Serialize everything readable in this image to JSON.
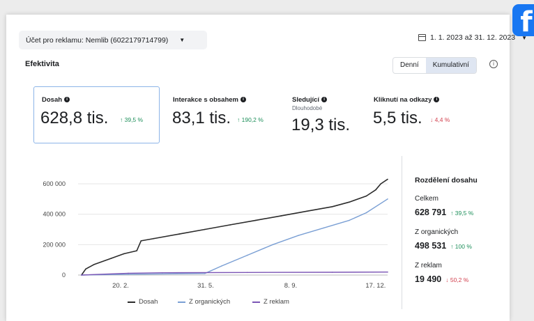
{
  "account": {
    "label": "Účet pro reklamu: Nemlib (6022179714799)"
  },
  "date_range": {
    "label": "1. 1. 2023 až 31. 12. 2023"
  },
  "section": {
    "title": "Efektivita"
  },
  "toggle": {
    "daily": "Denní",
    "cumulative": "Kumulativní",
    "active": "Kumulativní"
  },
  "metrics": [
    {
      "label": "Dosah",
      "value": "628,8 tis.",
      "delta": "↑ 39,5 %",
      "trend": "up"
    },
    {
      "label": "Interakce s obsahem",
      "value": "83,1 tis.",
      "delta": "↑ 190,2 %",
      "trend": "up"
    },
    {
      "label": "Sledující",
      "sub": "Dlouhodobé",
      "value": "19,3 tis."
    },
    {
      "label": "Kliknutí na odkazy",
      "value": "5,5 tis.",
      "delta": "↓ 4,4 %",
      "trend": "down"
    }
  ],
  "breakdown": {
    "title": "Rozdělení dosahu",
    "items": [
      {
        "label": "Celkem",
        "value": "628 791",
        "delta": "↑ 39,5 %",
        "trend": "up"
      },
      {
        "label": "Z organických",
        "value": "498 531",
        "delta": "↑ 100 %",
        "trend": "up"
      },
      {
        "label": "Z reklam",
        "value": "19 490",
        "delta": "↓ 50,2 %",
        "trend": "down"
      }
    ]
  },
  "colors": {
    "dosah": "#2b2b2b",
    "organic": "#7a9fd4",
    "ads": "#7b55b5",
    "up": "#1d8f5a",
    "down": "#d2404e"
  },
  "chart_data": {
    "type": "line",
    "ylim": [
      0,
      600000
    ],
    "y_ticks": [
      "600 000",
      "400 000",
      "200 000",
      "0"
    ],
    "x_ticks": [
      "20. 2.",
      "31. 5.",
      "8. 9.",
      "17. 12."
    ],
    "x_tick_days": [
      51,
      151,
      251,
      351
    ],
    "series": [
      {
        "name": "Dosah",
        "x_days": [
          5,
          10,
          20,
          40,
          55,
          70,
          75,
          90,
          120,
          150,
          180,
          210,
          240,
          270,
          300,
          320,
          340,
          351,
          357,
          365
        ],
        "values": [
          0,
          40000,
          70000,
          110000,
          140000,
          160000,
          225000,
          240000,
          270000,
          300000,
          330000,
          360000,
          390000,
          420000,
          450000,
          480000,
          520000,
          560000,
          600000,
          630000
        ]
      },
      {
        "name": "Z organických",
        "x_days": [
          5,
          60,
          150,
          170,
          200,
          230,
          260,
          290,
          320,
          340,
          365
        ],
        "values": [
          0,
          5000,
          10000,
          60000,
          130000,
          200000,
          260000,
          310000,
          360000,
          410000,
          500000
        ]
      },
      {
        "name": "Z reklam",
        "x_days": [
          5,
          60,
          100,
          200,
          300,
          365
        ],
        "values": [
          0,
          12000,
          15000,
          17000,
          18500,
          19500
        ]
      }
    ]
  }
}
